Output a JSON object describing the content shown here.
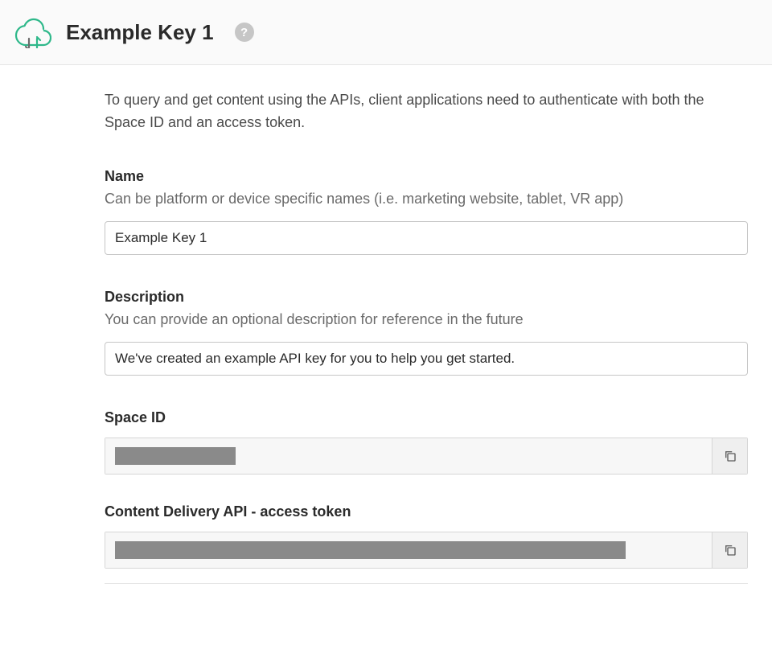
{
  "header": {
    "title": "Example Key 1"
  },
  "intro": "To query and get content using the APIs, client applications need to authenticate with both the Space ID and an access token.",
  "fields": {
    "name": {
      "label": "Name",
      "hint": "Can be platform or device specific names (i.e. marketing website, tablet, VR app)",
      "value": "Example Key 1"
    },
    "description": {
      "label": "Description",
      "hint": "You can provide an optional description for reference in the future",
      "value": "We've created an example API key for you to help you get started."
    },
    "spaceId": {
      "label": "Space ID"
    },
    "accessToken": {
      "label": "Content Delivery API - access token"
    }
  }
}
